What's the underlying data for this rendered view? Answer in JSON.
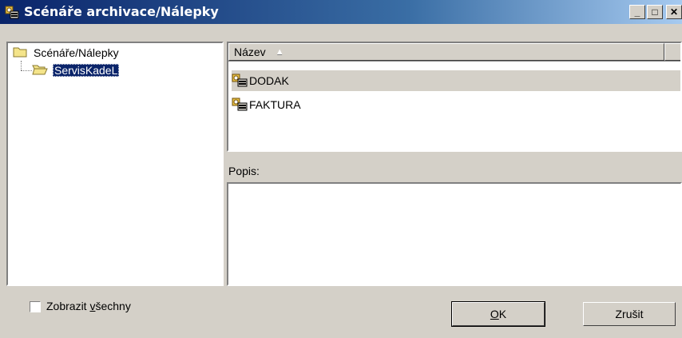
{
  "window": {
    "title": "Scénáře archivace/Nálepky",
    "controls": {
      "minimize": "_",
      "maximize": "□",
      "close": "✕"
    }
  },
  "tree": {
    "root_label": "Scénáře/Nálepky",
    "child_label": "ServisKadeL",
    "root_icon": "folder-icon",
    "child_icon": "folder-open-icon"
  },
  "list": {
    "columns": [
      {
        "label": "Název",
        "sort": "ascending"
      }
    ],
    "items": [
      {
        "label": "DODAK",
        "icon": "scenario-icon",
        "highlighted": true
      },
      {
        "label": "FAKTURA",
        "icon": "scenario-icon",
        "highlighted": false
      }
    ]
  },
  "description": {
    "label": "Popis:",
    "value": ""
  },
  "footer": {
    "show_all": {
      "prefix": "Zobrazit ",
      "accel": "v",
      "suffix": "šechny",
      "checked": false
    },
    "ok": {
      "accel": "O",
      "rest": "K"
    },
    "cancel": {
      "label": "Zrušit"
    }
  }
}
